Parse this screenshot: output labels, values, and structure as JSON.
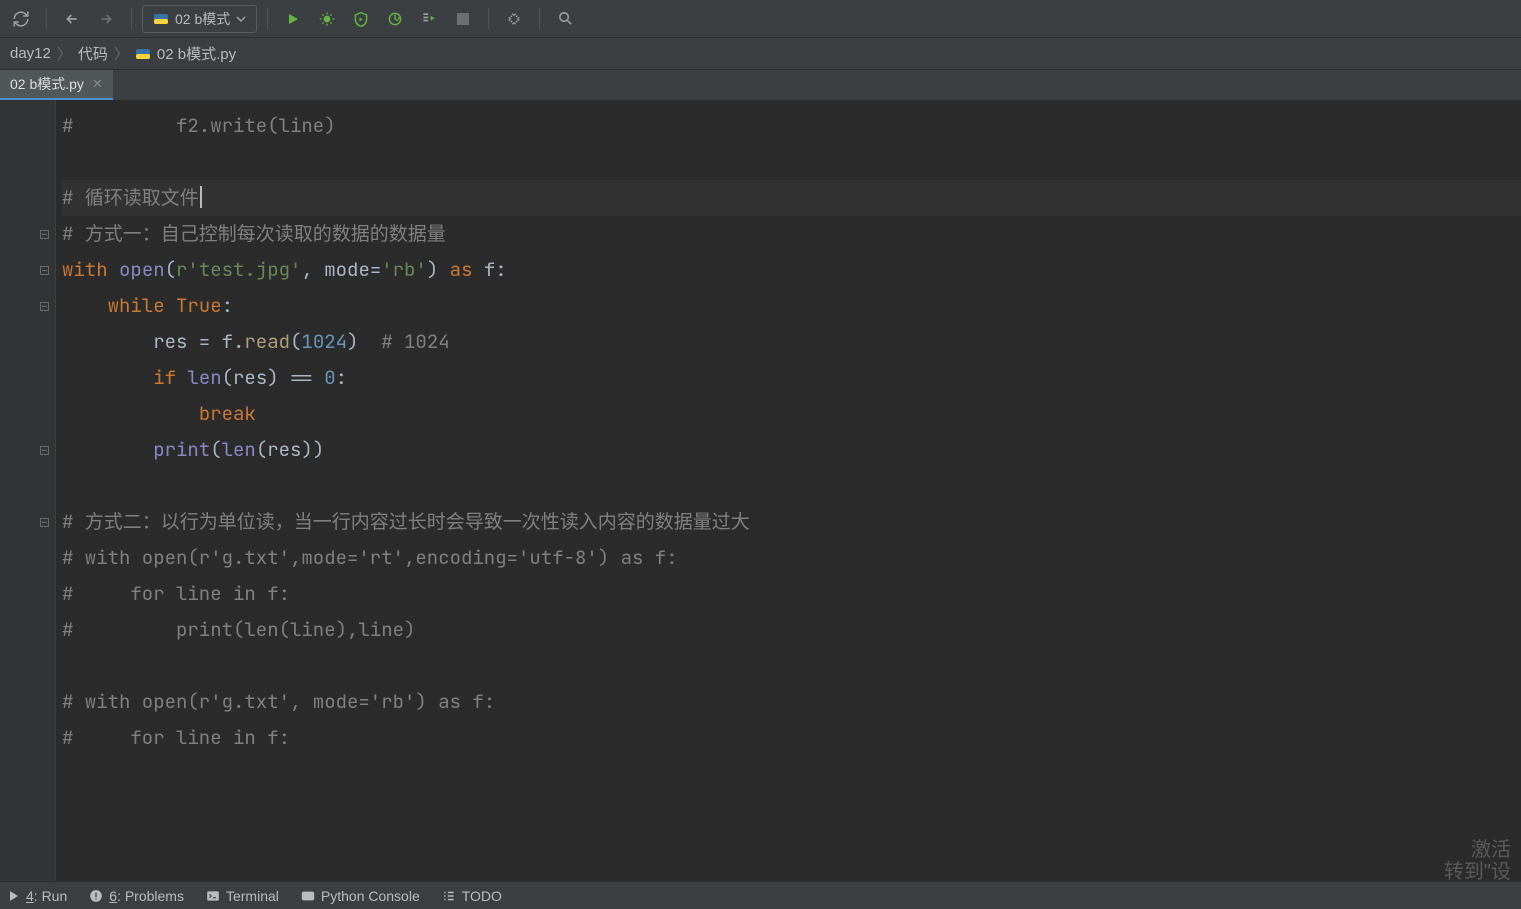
{
  "run_config": {
    "label": "02 b模式"
  },
  "breadcrumb": {
    "items": [
      "day12",
      "代码",
      "02 b模式.py"
    ]
  },
  "tab": {
    "label": "02 b模式.py"
  },
  "code": {
    "lines": [
      {
        "kind": "cmt",
        "text": "#         f2.write(line)"
      },
      {
        "kind": "blank",
        "text": ""
      },
      {
        "kind": "cmt-caret",
        "text": "# 循环读取文件"
      },
      {
        "kind": "cmt",
        "text": "# 方式一：自己控制每次读取的数据的数据量"
      },
      {
        "kind": "with",
        "parts": {
          "kw1": "with",
          "fn": "open",
          "str": "r'test.jpg'",
          "comma": ", ",
          "arg": "mode=",
          "str2": "'rb'",
          "kw2": "as",
          "var": "f"
        }
      },
      {
        "kind": "while",
        "parts": {
          "indent": "    ",
          "kw": "while",
          "val": "True"
        }
      },
      {
        "kind": "assign",
        "parts": {
          "indent": "        ",
          "lhs": "res = f.",
          "fn": "read",
          "num": "1024",
          "cmt": "# 1024"
        }
      },
      {
        "kind": "if",
        "parts": {
          "indent": "        ",
          "kw": "if",
          "builtin": "len",
          "arg": "res",
          "op": " == ",
          "num": "0"
        }
      },
      {
        "kind": "break",
        "parts": {
          "indent": "            ",
          "kw": "break"
        }
      },
      {
        "kind": "print",
        "parts": {
          "indent": "        ",
          "builtin": "print",
          "inner_builtin": "len",
          "arg": "res"
        }
      },
      {
        "kind": "blank",
        "text": ""
      },
      {
        "kind": "cmt",
        "text": "# 方式二：以行为单位读，当一行内容过长时会导致一次性读入内容的数据量过大"
      },
      {
        "kind": "cmt",
        "text": "# with open(r'g.txt',mode='rt',encoding='utf-8') as f:"
      },
      {
        "kind": "cmt",
        "text": "#     for line in f:"
      },
      {
        "kind": "cmt",
        "text": "#         print(len(line),line)"
      },
      {
        "kind": "blank",
        "text": ""
      },
      {
        "kind": "cmt",
        "text": "# with open(r'g.txt', mode='rb') as f:"
      },
      {
        "kind": "cmt",
        "text": "#     for line in f:"
      }
    ]
  },
  "bottom": {
    "run": "4: Run",
    "problems": "6: Problems",
    "terminal": "Terminal",
    "pyconsole": "Python Console",
    "todo": "TODO"
  },
  "watermark": {
    "l1": "激活",
    "l2": "转到\"设"
  }
}
